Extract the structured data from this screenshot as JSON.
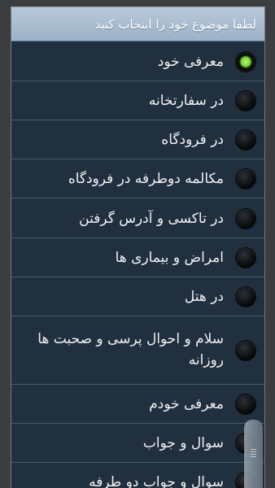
{
  "dialog": {
    "title": "لطفا موضوع خود را انتخاب کنید"
  },
  "options": [
    {
      "label": "معرفی خود",
      "selected": true
    },
    {
      "label": "در سفارتخانه",
      "selected": false
    },
    {
      "label": "در فرودگاه",
      "selected": false
    },
    {
      "label": "مکالمه دوطرفه در فرودگاه",
      "selected": false
    },
    {
      "label": "در تاکسی و آدرس گرفتن",
      "selected": false
    },
    {
      "label": "امراض و بیماری ها",
      "selected": false
    },
    {
      "label": "در هتل",
      "selected": false
    },
    {
      "label": "سلام و احوال پرسی و صحبت ها روزانه",
      "selected": false
    },
    {
      "label": "معرفی خودم",
      "selected": false
    },
    {
      "label": "سوال و جواب",
      "selected": false
    },
    {
      "label": "سوال و جواب دو طرفه",
      "selected": false
    }
  ],
  "colors": {
    "title_bar": "#a9bdd0",
    "list_background": "#21303f",
    "selected_radio": "#7fd33c",
    "backdrop": "#3c3d3f"
  },
  "icons": {
    "radio_off": "radio-unchecked-icon",
    "radio_on": "radio-checked-icon"
  }
}
